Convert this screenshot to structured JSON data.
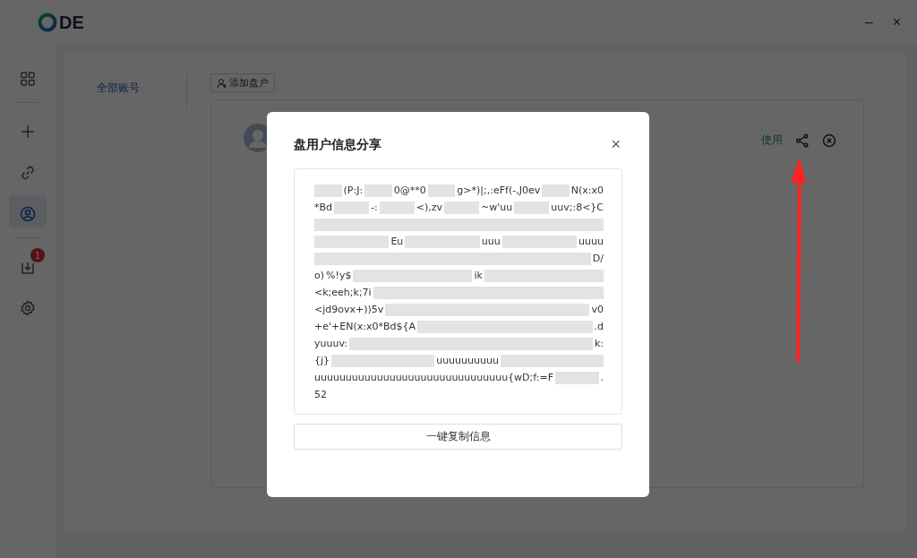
{
  "window": {
    "logo_text": "DE",
    "controls": [
      "–",
      "×"
    ]
  },
  "sidebar": {
    "items": [
      {
        "kind": "grid",
        "selected": false,
        "divider_after": true
      },
      {
        "kind": "plus",
        "selected": false
      },
      {
        "kind": "link",
        "selected": false
      },
      {
        "kind": "user",
        "selected": true,
        "divider_after": true
      },
      {
        "kind": "download",
        "selected": false,
        "badge": "1"
      },
      {
        "kind": "settings",
        "selected": false
      }
    ]
  },
  "tabs": [
    {
      "label": "全部账号",
      "selected": true
    }
  ],
  "add_button": "添加盘户",
  "account": {
    "action": "使用"
  },
  "modal": {
    "title": "盘用户信息分享",
    "close": "×",
    "lines": [
      [
        {
          "kind": "redacted"
        },
        {
          "kind": "text",
          "text": "(P:J:"
        },
        {
          "kind": "redacted"
        },
        {
          "kind": "text",
          "text": "0@**0"
        },
        {
          "kind": "redacted"
        },
        {
          "kind": "text",
          "text": "g>*)|;,:eFf(-,J0ev"
        },
        {
          "kind": "redacted"
        },
        {
          "kind": "text",
          "text": "N(x:x0"
        }
      ],
      [
        {
          "kind": "text",
          "text": "*Bd"
        },
        {
          "kind": "redacted"
        },
        {
          "kind": "text",
          "text": "-:"
        },
        {
          "kind": "redacted"
        },
        {
          "kind": "text",
          "text": "<),zv"
        },
        {
          "kind": "redacted"
        },
        {
          "kind": "text",
          "text": "~w'uu"
        },
        {
          "kind": "redacted"
        },
        {
          "kind": "text",
          "text": "uuv;:8<}C"
        }
      ],
      [
        {
          "kind": "redacted"
        }
      ],
      [
        {
          "kind": "redacted"
        },
        {
          "kind": "text",
          "text": "Eu"
        },
        {
          "kind": "redacted"
        },
        {
          "kind": "text",
          "text": "uuu"
        },
        {
          "kind": "redacted"
        },
        {
          "kind": "text",
          "text": "uuuu"
        }
      ],
      [
        {
          "kind": "redacted"
        },
        {
          "kind": "text",
          "text": "D/"
        }
      ],
      [
        {
          "kind": "text",
          "text": "o)"
        },
        {
          "kind": "text",
          "text": "%!y$"
        },
        {
          "kind": "redacted"
        },
        {
          "kind": "text",
          "text": "ik"
        },
        {
          "kind": "redacted"
        }
      ],
      [
        {
          "kind": "text",
          "text": "<k;eeh;k;7i"
        },
        {
          "kind": "redacted"
        }
      ],
      [
        {
          "kind": "text",
          "text": "<jd9ovx+))5v"
        },
        {
          "kind": "redacted"
        },
        {
          "kind": "text",
          "text": "v0"
        }
      ],
      [
        {
          "kind": "text",
          "text": "+e'+EN(x:x0*Bd${A"
        },
        {
          "kind": "redacted"
        },
        {
          "kind": "text",
          "text": ".d"
        }
      ],
      [
        {
          "kind": "text",
          "text": "yuuuv:"
        },
        {
          "kind": "redacted"
        },
        {
          "kind": "text",
          "text": "k:"
        }
      ],
      [
        {
          "kind": "text",
          "text": "{j}"
        },
        {
          "kind": "redacted"
        },
        {
          "kind": "text",
          "text": "uuuuuuuuuu"
        },
        {
          "kind": "redacted"
        }
      ],
      [
        {
          "kind": "text",
          "text": "uuuuuuuuuuuuuuuuuuuuuuuuuuuuuuu{wD;f:=F"
        },
        {
          "kind": "redacted"
        },
        {
          "kind": "text",
          "text": "."
        }
      ],
      [
        {
          "kind": "text",
          "text": "52"
        }
      ]
    ],
    "copy_button": "一键复制信息"
  }
}
